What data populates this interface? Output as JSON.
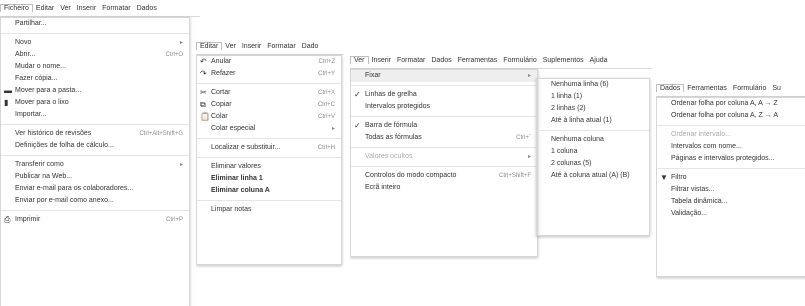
{
  "panel1": {
    "menubar": [
      "Ficheiro",
      "Editar",
      "Ver",
      "Inserir",
      "Formatar",
      "Dados"
    ],
    "menu": [
      {
        "label": "Partilhar..."
      },
      {
        "sep": true
      },
      {
        "label": "Novo",
        "shortcut": "▸"
      },
      {
        "label": "Abrir...",
        "shortcut": "Ctrl+O"
      },
      {
        "label": "Mudar o nome..."
      },
      {
        "label": "Fazer cópia..."
      },
      {
        "label": "Mover para a pasta...",
        "icon": "folder-icon",
        "glyph": "▬"
      },
      {
        "label": "Mover para o lixo",
        "icon": "trash-icon",
        "glyph": "▮"
      },
      {
        "label": "Importar..."
      },
      {
        "sep": true
      },
      {
        "label": "Ver histórico de revisões",
        "shortcut": "Ctrl+Alt+Shift+G"
      },
      {
        "label": "Definições de folha de cálculo..."
      },
      {
        "sep": true
      },
      {
        "label": "Transferir como",
        "shortcut": "▸"
      },
      {
        "label": "Publicar na Web..."
      },
      {
        "label": "Enviar e-mail para os colaboradores..."
      },
      {
        "label": "Enviar por e-mail como anexo..."
      },
      {
        "sep": true
      },
      {
        "label": "Imprimir",
        "shortcut": "Ctrl+P",
        "icon": "print-icon",
        "glyph": "⎙"
      }
    ]
  },
  "panel2": {
    "menubar": [
      "Editar",
      "Ver",
      "Inserir",
      "Formatar",
      "Dado"
    ],
    "menu": [
      {
        "label": "Anular",
        "shortcut": "Ctrl+Z",
        "icon": "undo-icon",
        "glyph": "↶"
      },
      {
        "label": "Refazer",
        "shortcut": "Ctrl+Y",
        "icon": "redo-icon",
        "glyph": "↷"
      },
      {
        "sep": true
      },
      {
        "label": "Cortar",
        "shortcut": "Ctrl+X",
        "icon": "scissors-icon",
        "glyph": "✂"
      },
      {
        "label": "Copiar",
        "shortcut": "Ctrl+C",
        "icon": "copy-icon",
        "glyph": "⧉"
      },
      {
        "label": "Colar",
        "shortcut": "Ctrl+V",
        "icon": "paste-icon",
        "glyph": "📋"
      },
      {
        "label": "Colar especial",
        "shortcut": "▸"
      },
      {
        "sep": true
      },
      {
        "label": "Localizar e substituir...",
        "shortcut": "Ctrl+H"
      },
      {
        "sep": true
      },
      {
        "label": "Eliminar valores"
      },
      {
        "label": "Eliminar linha 1",
        "bold": true
      },
      {
        "label": "Eliminar coluna A",
        "bold": true
      },
      {
        "sep": true
      },
      {
        "label": "Limpar notas"
      }
    ]
  },
  "panel3": {
    "menubar": [
      "Ver",
      "Inserir",
      "Formatar",
      "Dados",
      "Ferramentas",
      "Formulário",
      "Suplementos",
      "Ajuda"
    ],
    "menu": [
      {
        "label": "Fixar",
        "shortcut": "▸",
        "highlight": true
      },
      {
        "sep": true
      },
      {
        "label": "Linhas de grelha",
        "icon": "check-icon",
        "glyph": "✓"
      },
      {
        "label": "Intervalos protegidos"
      },
      {
        "sep": true
      },
      {
        "label": "Barra de fórmula",
        "icon": "check-icon",
        "glyph": "✓"
      },
      {
        "label": "Todas as fórmulas",
        "shortcut": "Ctrl+`"
      },
      {
        "sep": true
      },
      {
        "label": "Valores ocultos",
        "shortcut": "▸",
        "disabled": true
      },
      {
        "sep": true
      },
      {
        "label": "Controlos do modo compacto",
        "shortcut": "Ctrl+Shift+F"
      },
      {
        "label": "Ecrã inteiro"
      }
    ],
    "submenu": [
      {
        "label": "Nenhuma linha (6)"
      },
      {
        "label": "1 linha (1)"
      },
      {
        "label": "2 linhas (2)"
      },
      {
        "label": "Até à linha atual (1)"
      },
      {
        "sep": true
      },
      {
        "label": "Nenhuma coluna"
      },
      {
        "label": "1 coluna"
      },
      {
        "label": "2 colunas (5)"
      },
      {
        "label": "Até à coluna atual (A) (B)"
      }
    ]
  },
  "panel4": {
    "menubar": [
      "Dados",
      "Ferramentas",
      "Formulário",
      "Su"
    ],
    "menu": [
      {
        "label": "Ordenar folha por coluna A, A → Z"
      },
      {
        "label": "Ordenar folha por coluna A, Z → A"
      },
      {
        "sep": true
      },
      {
        "label": "Ordenar intervalo...",
        "disabled": true
      },
      {
        "label": "Intervalos com nome..."
      },
      {
        "label": "Páginas e intervalos protegidos..."
      },
      {
        "sep": true
      },
      {
        "label": "Filtro",
        "icon": "filter-icon",
        "glyph": "▼"
      },
      {
        "label": "Filtrar vistas...",
        "shortcut": "▸"
      },
      {
        "label": "Tabela dinâmica..."
      },
      {
        "label": "Validação..."
      }
    ]
  }
}
